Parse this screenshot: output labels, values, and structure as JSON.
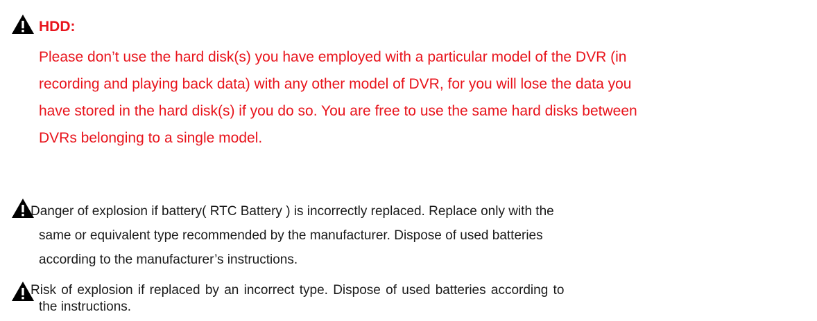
{
  "hdd": {
    "icon": "warning-triangle-icon",
    "title": "HDD:",
    "title_color": "#e8141c",
    "lines": [
      "Please don’t use the hard disk(s) you have employed with a particular model of the DVR (in",
      "recording and playing back data) with any other model of DVR, for you will lose the data you",
      "have stored in the hard disk(s) if you do so. You are free to use the same hard disks between",
      "DVRs belonging to a single model."
    ]
  },
  "battery_notice": {
    "icon": "warning-triangle-icon",
    "lines": [
      "Danger of explosion if battery( RTC Battery ) is incorrectly replaced. Replace only with the",
      "same or equivalent type recommended by the manufacturer. Dispose of used batteries",
      "according to the manufacturer’s instructions."
    ]
  },
  "replacement_notice": {
    "icon": "warning-triangle-icon",
    "lines": [
      "Risk of explosion if replaced by an incorrect type. Dispose of used batteries according to",
      "the instructions."
    ]
  }
}
